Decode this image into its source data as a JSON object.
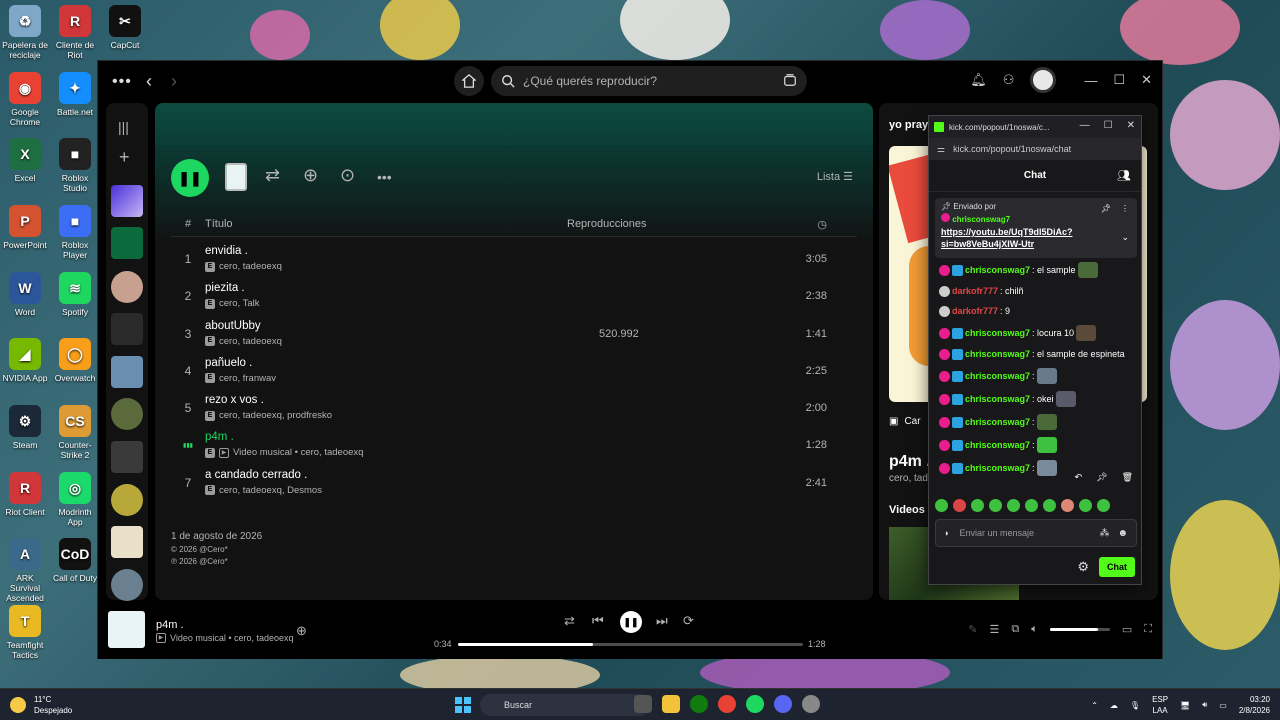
{
  "desktop": {
    "icons": [
      {
        "label": "Papelera de reciclaje",
        "color": "#7fa7c7",
        "glyph": "♻"
      },
      {
        "label": "Cliente de Riot",
        "color": "#d13639",
        "glyph": "R"
      },
      {
        "label": "CapCut",
        "color": "#111111",
        "glyph": "✂"
      },
      {
        "label": "Google Chrome",
        "color": "#e94235",
        "glyph": "◉"
      },
      {
        "label": "Battle.net",
        "color": "#148eff",
        "glyph": "✦"
      },
      {
        "label": "Excel",
        "color": "#1d6f42",
        "glyph": "X"
      },
      {
        "label": "Roblox Studio",
        "color": "#222222",
        "glyph": "■"
      },
      {
        "label": "PowerPoint",
        "color": "#d35230",
        "glyph": "P"
      },
      {
        "label": "Roblox Player",
        "color": "#3b6df5",
        "glyph": "■"
      },
      {
        "label": "Word",
        "color": "#2b579a",
        "glyph": "W"
      },
      {
        "label": "Spotify",
        "color": "#1ed760",
        "glyph": "≋"
      },
      {
        "label": "NVIDIA App",
        "color": "#76b900",
        "glyph": "◢"
      },
      {
        "label": "Overwatch",
        "color": "#f99e1a",
        "glyph": "◯"
      },
      {
        "label": "Steam",
        "color": "#1b2838",
        "glyph": "⚙"
      },
      {
        "label": "Counter-Strike 2",
        "color": "#de9b35",
        "glyph": "CS"
      },
      {
        "label": "Riot Client",
        "color": "#d13639",
        "glyph": "R"
      },
      {
        "label": "Modrinth App",
        "color": "#1bd96a",
        "glyph": "◎"
      },
      {
        "label": "ARK Survival Ascended",
        "color": "#3a6a8a",
        "glyph": "A"
      },
      {
        "label": "Call of Duty",
        "color": "#111111",
        "glyph": "CoD"
      },
      {
        "label": "Teamfight Tactics",
        "color": "#e8b923",
        "glyph": "T"
      }
    ]
  },
  "spotify": {
    "search_placeholder": "¿Qué querés reproducir?",
    "list_label": "Lista",
    "col_title": "Título",
    "col_plays": "Reproducciones",
    "col_hash": "#",
    "tracks": [
      {
        "num": "1",
        "title": "envidia .",
        "artists": "cero, tadeoexq",
        "plays": "",
        "duration": "3:05",
        "playing": false,
        "video": false
      },
      {
        "num": "2",
        "title": "piezita .",
        "artists": "cero, Talk",
        "plays": "",
        "duration": "2:38",
        "playing": false,
        "video": false
      },
      {
        "num": "3",
        "title": "aboutUbby",
        "artists": "cero, tadeoexq",
        "plays": "520.992",
        "duration": "1:41",
        "playing": false,
        "video": false
      },
      {
        "num": "4",
        "title": "pañuelo .",
        "artists": "cero, franwav",
        "plays": "",
        "duration": "2:25",
        "playing": false,
        "video": false
      },
      {
        "num": "5",
        "title": "rezo x vos .",
        "artists": "cero, tadeoexq, prodfresko",
        "plays": "",
        "duration": "2:00",
        "playing": false,
        "video": false
      },
      {
        "num": "",
        "title": "p4m .",
        "artists": "Video musical • cero, tadeoexq",
        "plays": "",
        "duration": "1:28",
        "playing": true,
        "video": true
      },
      {
        "num": "7",
        "title": "a candado cerrado .",
        "artists": "cero, tadeoexq, Desmos",
        "plays": "",
        "duration": "2:41",
        "playing": false,
        "video": false
      }
    ],
    "release_date": "1 de agosto de 2026",
    "copyright_c": "© 2026 @Cero*",
    "copyright_p": "℗ 2026 @Cero*",
    "right_panel": {
      "title": "yo pray .",
      "canvas_label": "Car",
      "song": "p4m .",
      "artist": "cero, tad",
      "videos_label": "Videos m"
    },
    "player": {
      "title": "p4m .",
      "subtitle": "Video musical • cero, tadeoexq",
      "elapsed": "0:34",
      "total": "1:28",
      "progress": 0.39,
      "volume": 0.8
    }
  },
  "kick": {
    "window_title": "kick.com/popout/1noswa/c...",
    "url": "kick.com/popout/1noswa/chat",
    "header": "Chat",
    "pinned_by_label": "Enviado por",
    "pinned_user": "chrisconswag7",
    "pinned_link": "https://youtu.be/UqT9dl5DiAc?si=bw8VeBu4jXIW-Utr",
    "messages": [
      {
        "user": "chrisconswag7",
        "color": "#53fc18",
        "text": ": el sample",
        "badge": "sub",
        "emote": true
      },
      {
        "user": "darkofr777",
        "color": "#e64545",
        "text": ": chilñ",
        "badge": "nine",
        "emote": false
      },
      {
        "user": "darkofr777",
        "color": "#e64545",
        "text": ": 9",
        "badge": "nine",
        "emote": false
      },
      {
        "user": "chrisconswag7",
        "color": "#53fc18",
        "text": ": locura 10",
        "badge": "sub",
        "emote": true
      },
      {
        "user": "chrisconswag7",
        "color": "#53fc18",
        "text": ": el sample de espineta",
        "badge": "sub",
        "emote": false
      },
      {
        "user": "chrisconswag7",
        "color": "#53fc18",
        "text": ":",
        "badge": "sub",
        "emote": true
      },
      {
        "user": "chrisconswag7",
        "color": "#53fc18",
        "text": ": okei",
        "badge": "sub",
        "emote": true
      },
      {
        "user": "chrisconswag7",
        "color": "#53fc18",
        "text": ":",
        "badge": "sub",
        "emote": true
      },
      {
        "user": "chrisconswag7",
        "color": "#53fc18",
        "text": ":",
        "badge": "sub",
        "emote": true
      },
      {
        "user": "chrisconswag7",
        "color": "#53fc18",
        "text": ":",
        "badge": "sub",
        "emote": true
      }
    ],
    "input_placeholder": "Enviar un mensaje",
    "chat_button": "Chat"
  },
  "taskbar": {
    "weather_temp": "11°C",
    "weather_desc": "Despejado",
    "search_label": "Buscar",
    "lang_top": "ESP",
    "lang_bottom": "LAA",
    "time": "03:20",
    "date": "2/8/2026"
  }
}
